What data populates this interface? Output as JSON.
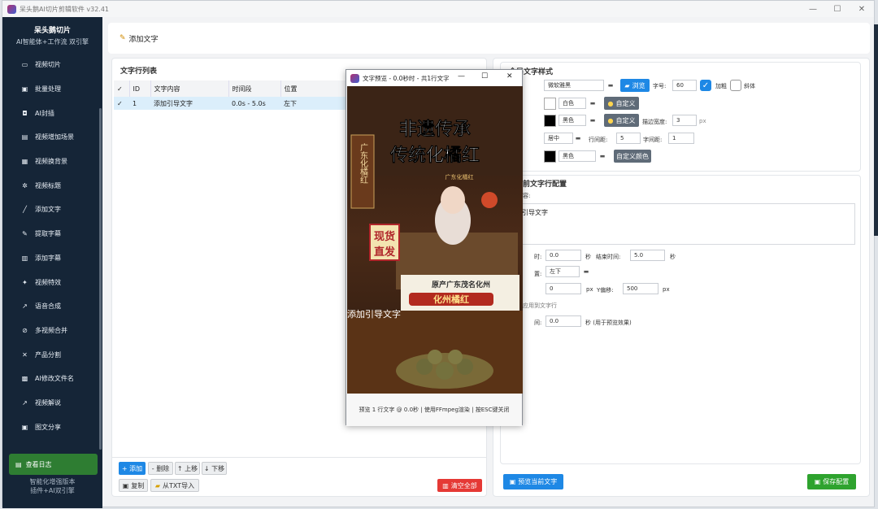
{
  "window": {
    "title": "呆头鹅AI切片剪辑软件 v32.41",
    "min": "—",
    "max": "☐",
    "close": "✕"
  },
  "sidebar": {
    "brand_title": "呆头鹅切片",
    "brand_sub": "AI智能体+工作流 双引擎",
    "items": [
      {
        "icon": "▭",
        "label": "视频切片"
      },
      {
        "icon": "▣",
        "label": "批量处理"
      },
      {
        "icon": "◘",
        "label": "AI封插"
      },
      {
        "icon": "▤",
        "label": "视频增加场景"
      },
      {
        "icon": "▦",
        "label": "视频换背景"
      },
      {
        "icon": "✲",
        "label": "视频标题"
      },
      {
        "icon": "╱",
        "label": "添加文字"
      },
      {
        "icon": "✎",
        "label": "提取字幕"
      },
      {
        "icon": "▥",
        "label": "添加字幕"
      },
      {
        "icon": "✦",
        "label": "视频特效"
      },
      {
        "icon": "↗",
        "label": "语音合成"
      },
      {
        "icon": "⊘",
        "label": "多视频合并"
      },
      {
        "icon": "✕",
        "label": "产品分割"
      },
      {
        "icon": "▩",
        "label": "AI修改文件名"
      },
      {
        "icon": "↗",
        "label": "视频解说"
      },
      {
        "icon": "▣",
        "label": "图文分享"
      }
    ],
    "log_button": "查看日志",
    "footer1": "智能化增强版本",
    "footer2": "插件+AI双引擎"
  },
  "header": {
    "title": "添加文字"
  },
  "list": {
    "title": "文字行列表",
    "columns": [
      "✓",
      "ID",
      "文字内容",
      "时间段",
      "位置"
    ],
    "rows": [
      {
        "check": "✓",
        "id": "1",
        "text": "添加引导文字",
        "time": "0.0s - 5.0s",
        "pos": "左下"
      }
    ],
    "buttons": {
      "add": "+ 添加",
      "del": "- 删除",
      "up": "↑ 上移",
      "down": "↓ 下移",
      "copy": "复制",
      "import": "从TXT导入",
      "clear": "清空全部"
    }
  },
  "style": {
    "title": "全局文字样式",
    "font_value": "微软雅黑",
    "browse": "浏览",
    "size_label": "字号:",
    "size_value": "60",
    "bold": "加粗",
    "italic": "斜体",
    "color1": "白色",
    "custom": "自定义",
    "color2": "黑色",
    "stroke_label": "描边宽度:",
    "stroke_value": "3",
    "px": "px",
    "align": "居中",
    "line_label": "行间距:",
    "line_value": "5",
    "char_label": "字间距:",
    "char_value": "1",
    "color3": "黑色",
    "custom_color": "自定义颜色"
  },
  "config": {
    "title": "文字行配置",
    "prefix": "当前",
    "text_label": "容:",
    "text_value": "引导文字",
    "start_label": "时:",
    "start_value": "0.0",
    "sec": "秒",
    "end_label": "结束时间:",
    "end_value": "5.0",
    "pos_label": "置:",
    "pos_value": "左下",
    "x_value": "0",
    "y_label": "Y偏移:",
    "y_value": "500",
    "row_note": "应用到文字行",
    "prev_label": "间:",
    "prev_value": "0.0",
    "prev_hint": "秒 (用于预览效果)",
    "preview_btn": "预览当前文字",
    "save_btn": "保存配置"
  },
  "preview": {
    "title": "文字预览 - 0.0秒时 - 共1行文字",
    "overlay": "添加引导文字",
    "status": "预览 1 行文字 @ 0.0秒 | 使用FFmpeg渲染 | 按ESC键关闭",
    "poster_title1": "非遗传承",
    "poster_title2": "传统化橘红",
    "sign": "广东化橘红",
    "badge1": "现货",
    "badge2": "直发",
    "banner1": "原产广东茂名化州",
    "banner2": "化州橘红",
    "plaque": "广东化橘红"
  }
}
